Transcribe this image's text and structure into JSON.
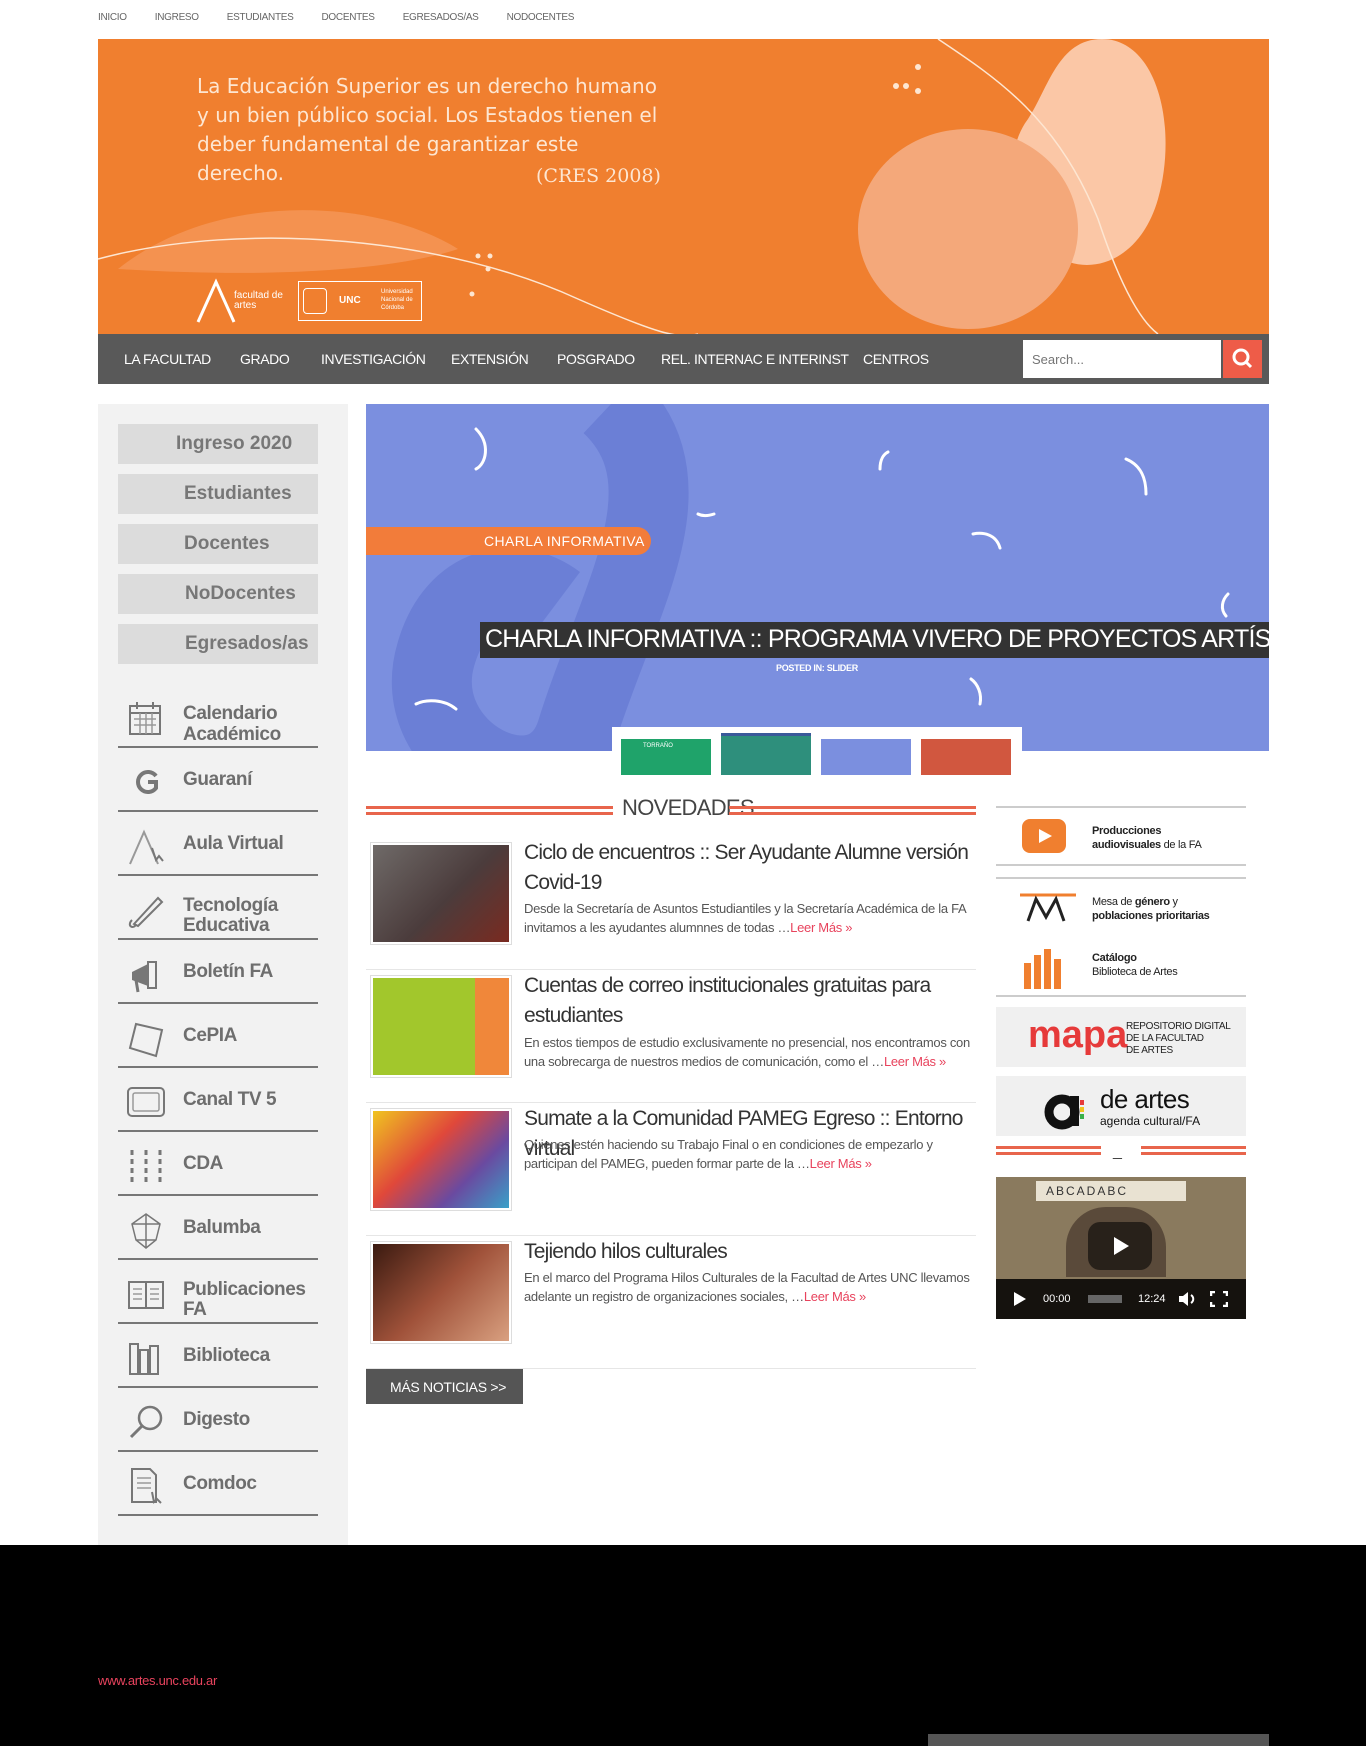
{
  "top_nav": [
    "INICIO",
    "INGRESO",
    "ESTUDIANTES",
    "DOCENTES",
    "EGRESADOS/AS",
    "NODOCENTES"
  ],
  "banner": {
    "quote": "La Educación Superior es un derecho humano y un bien público social. Los Estados tienen el deber fundamental de garantizar este derecho.",
    "citation": "(CRES 2008)",
    "logo_fa": "facultad de artes",
    "logo_unc_abbr": "UNC",
    "logo_unc_name": "Universidad Nacional de Córdoba"
  },
  "main_nav": [
    "LA FACULTAD",
    "GRADO",
    "INVESTIGACIÓN",
    "EXTENSIÓN",
    "POSGRADO",
    "REL. INTERNAC E INTERINST",
    "CENTROS"
  ],
  "search": {
    "placeholder": "Search...",
    "icon": "search-icon"
  },
  "sidebar": {
    "pills": [
      "Ingreso 2020",
      "Estudiantes",
      "Docentes",
      "NoDocentes",
      "Egresados/as"
    ],
    "links": [
      {
        "label1": "Calendario",
        "label2": "Académico",
        "icon": "calendar-icon"
      },
      {
        "label1": "Guaraní",
        "label2": "",
        "icon": "guarani-icon"
      },
      {
        "label1": "Aula Virtual",
        "label2": "",
        "icon": "aula-virtual-icon"
      },
      {
        "label1": "Tecnología",
        "label2": "Educativa",
        "icon": "pencil-icon"
      },
      {
        "label1": "Boletín FA",
        "label2": "",
        "icon": "megaphone-icon"
      },
      {
        "label1": "CePIA",
        "label2": "",
        "icon": "cepia-icon"
      },
      {
        "label1": "Canal TV 5",
        "label2": "",
        "icon": "tv-icon"
      },
      {
        "label1": "CDA",
        "label2": "",
        "icon": "cda-icon"
      },
      {
        "label1": "Balumba",
        "label2": "",
        "icon": "balumba-icon"
      },
      {
        "label1": "Publicaciones",
        "label2": "FA",
        "icon": "newspaper-icon"
      },
      {
        "label1": "Biblioteca",
        "label2": "",
        "icon": "library-icon"
      },
      {
        "label1": "Digesto",
        "label2": "",
        "icon": "magnifier-icon"
      },
      {
        "label1": "Comdoc",
        "label2": "",
        "icon": "document-icon"
      }
    ]
  },
  "slider": {
    "tag": "CHARLA INFORMATIVA",
    "title": "CHARLA INFORMATIVA :: PROGRAMA VIVERO DE PROYECTOS ARTÍSTICOS",
    "posted": "POSTED IN: SLIDER",
    "thumb_label": "TORRAÑO"
  },
  "novedades": {
    "title": "NOVEDADES",
    "items": [
      {
        "title": "Ciclo de encuentros :: Ser Ayudante Alumne versión Covid-19",
        "text": "Desde la Secretaría de Asuntos Estudiantiles y la Secretaría Académica de la FA invitamos a les ayudantes alumnnes de todas …",
        "more": "Leer Más »"
      },
      {
        "title": "Cuentas de correo institucionales gratuitas para estudiantes",
        "text": "En estos tiempos de estudio exclusivamente no presencial, nos encontramos con una sobrecarga de nuestros medios de comunicación, como el …",
        "more": "Leer Más »"
      },
      {
        "title": "Sumate a la Comunidad PAMEG Egreso :: Entorno virtual",
        "text": "Quienes estén haciendo su  Trabajo Final o en condiciones de empezarlo y participan del PAMEG, pueden formar parte de la …",
        "more": "Leer Más »"
      },
      {
        "title": "Tejiendo hilos culturales",
        "text": "En el marco del Programa Hilos Culturales de la Facultad de Artes UNC llevamos adelante un registro de organizaciones sociales, …",
        "more": "Leer Más »"
      }
    ],
    "more_button": "MÁS NOTICIAS  >>"
  },
  "right": {
    "produccion_1": "Producciones",
    "produccion_2a": "audiovisuales",
    "produccion_2b": " de la FA",
    "mesa_1a": "Mesa de ",
    "mesa_1b": "género",
    "mesa_1c": " y",
    "mesa_2": "poblaciones prioritarias",
    "catalogo_1": "Catálogo",
    "catalogo_2": "Biblioteca de Artes",
    "repo_1": "REPOSITORIO DIGITAL",
    "repo_2": "DE LA FACULTAD",
    "repo_3": "DE ARTES",
    "repo_logo": "mapa",
    "deartes_1": "de artes",
    "deartes_2": "agenda cultural/FA",
    "divider": "_",
    "video_current": "00:00",
    "video_duration": "12:24",
    "video_sign": "ABCADABC"
  },
  "footer": {
    "url": "www.artes.unc.edu.ar"
  },
  "colors": {
    "orange": "#f07f2f",
    "nav": "#595959",
    "accent": "#ee5c48",
    "slider_bg": "#7b8fdf",
    "link": "#e8435d"
  }
}
